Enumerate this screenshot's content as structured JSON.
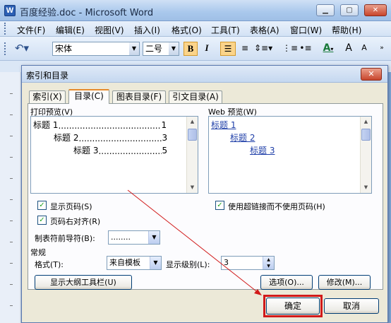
{
  "window": {
    "title": "百度经验.doc - Microsoft Word",
    "app_icon": "word-doc-icon",
    "controls": [
      "minimize-icon",
      "maximize-icon",
      "close-icon"
    ]
  },
  "menu": [
    "文件(F)",
    "编辑(E)",
    "视图(V)",
    "插入(I)",
    "格式(O)",
    "工具(T)",
    "表格(A)",
    "窗口(W)",
    "帮助(H)"
  ],
  "toolbar": {
    "font_name": "宋体",
    "font_size": "二号",
    "bold": "B",
    "italic": "I",
    "color_letter": "A",
    "grow": "A",
    "shrink": "A"
  },
  "dialog": {
    "title": "索引和目录",
    "tabs": [
      "索引(X)",
      "目录(C)",
      "图表目录(F)",
      "引文目录(A)"
    ],
    "active_tab": "目录(C)",
    "print_preview_label": "打印预览(V)",
    "print_preview": [
      {
        "text": "标题 1",
        "page": "1"
      },
      {
        "text": "标题 2",
        "page": "3"
      },
      {
        "text": "标题 3",
        "page": "5"
      }
    ],
    "web_preview_label": "Web 预览(W)",
    "web_preview": [
      "标题 1",
      "标题 2",
      "标题 3"
    ],
    "show_page_numbers": {
      "label": "显示页码(S)",
      "checked": true
    },
    "right_align_page_numbers": {
      "label": "页码右对齐(R)",
      "checked": true
    },
    "use_hyperlinks": {
      "label": "使用超链接而不使用页码(H)",
      "checked": true
    },
    "tab_leader_label": "制表符前导符(B):",
    "tab_leader_value": "........",
    "general_label": "常规",
    "formats_label": "格式(T):",
    "formats_value": "来自模板",
    "show_levels_label": "显示级别(L):",
    "show_levels_value": "3",
    "outline_toolbar_button": "显示大纲工具栏(U)",
    "options_button": "选项(O)...",
    "modify_button": "修改(M)...",
    "ok_button": "确定",
    "cancel_button": "取消",
    "highlight_color": "#d11a1a"
  }
}
